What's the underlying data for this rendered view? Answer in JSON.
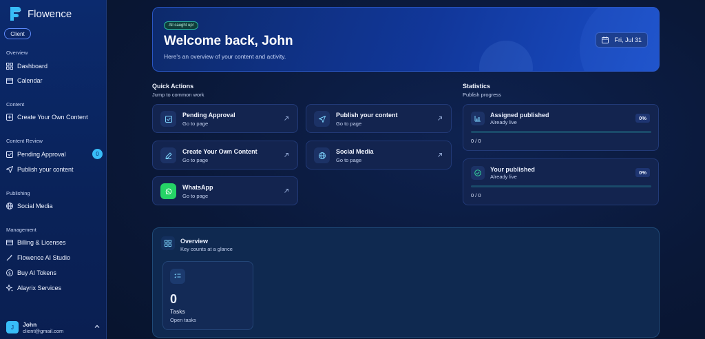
{
  "brand": {
    "name": "Flowence"
  },
  "role": "Client",
  "sidebar": {
    "sections": [
      {
        "label": "Overview",
        "items": [
          {
            "label": "Dashboard",
            "icon": "grid-icon"
          },
          {
            "label": "Calendar",
            "icon": "calendar-icon"
          }
        ]
      },
      {
        "label": "Content",
        "items": [
          {
            "label": "Create Your Own Content",
            "icon": "plus-square-icon"
          }
        ]
      },
      {
        "label": "Content Review",
        "items": [
          {
            "label": "Pending Approval",
            "icon": "check-square-icon",
            "badge": "0"
          },
          {
            "label": "Publish your content",
            "icon": "send-icon"
          }
        ]
      },
      {
        "label": "Publishing",
        "items": [
          {
            "label": "Social Media",
            "icon": "globe-icon"
          }
        ]
      },
      {
        "label": "Management",
        "items": [
          {
            "label": "Billing & Licenses",
            "icon": "card-icon"
          },
          {
            "label": "Flowence AI Studio",
            "icon": "wand-icon"
          },
          {
            "label": "Buy AI Tokens",
            "icon": "coin-icon"
          },
          {
            "label": "Alayrix Services",
            "icon": "sparkle-icon"
          }
        ]
      }
    ]
  },
  "user": {
    "initial": "J",
    "name": "John",
    "email": "client@gmail.com"
  },
  "hero": {
    "badge": "All caught up!",
    "title": "Welcome back, John",
    "subtitle": "Here's an overview of your content and activity.",
    "date": "Fri, Jul 31"
  },
  "quick_actions": {
    "title": "Quick Actions",
    "subtitle": "Jump to common work",
    "items": [
      {
        "title": "Pending Approval",
        "sub": "Go to page",
        "icon": "check-square-icon"
      },
      {
        "title": "Publish your content",
        "sub": "Go to page",
        "icon": "send-icon"
      },
      {
        "title": "Create Your Own Content",
        "sub": "Go to page",
        "icon": "pencil-icon"
      },
      {
        "title": "Social Media",
        "sub": "Go to page",
        "icon": "globe-icon"
      },
      {
        "title": "WhatsApp",
        "sub": "Go to page",
        "icon": "whatsapp-icon"
      }
    ]
  },
  "statistics": {
    "title": "Statistics",
    "subtitle": "Publish progress",
    "cards": [
      {
        "title": "Assigned published",
        "sub": "Already live",
        "pct": "0%",
        "count": "0 / 0",
        "progress": 0
      },
      {
        "title": "Your published",
        "sub": "Already live",
        "pct": "0%",
        "count": "0 / 0",
        "progress": 0
      }
    ]
  },
  "overview": {
    "title": "Overview",
    "subtitle": "Key counts at a glance",
    "task": {
      "value": "0",
      "label": "Tasks",
      "sub": "Open tasks"
    }
  },
  "colors": {
    "accent": "#38bdf8",
    "whatsapp": "#25d366",
    "sidebar": "#0b2a6e"
  }
}
